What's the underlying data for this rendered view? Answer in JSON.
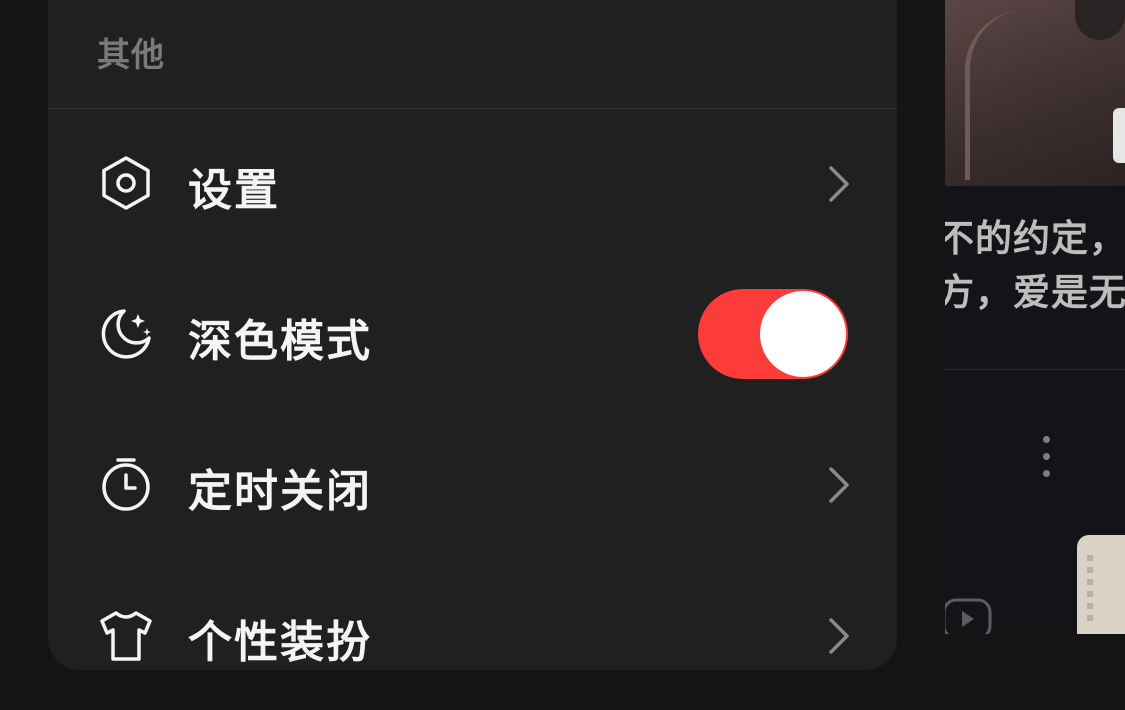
{
  "menu": {
    "section_title": "其他",
    "items": [
      {
        "icon": "settings-hexagon-icon",
        "label": "设置",
        "control": "chevron"
      },
      {
        "icon": "moon-stars-icon",
        "label": "深色模式",
        "control": "toggle",
        "toggle_on": true
      },
      {
        "icon": "timer-icon",
        "label": "定时关闭",
        "control": "chevron"
      },
      {
        "icon": "tshirt-icon",
        "label": "个性装扮",
        "control": "chevron"
      }
    ]
  },
  "feed": {
    "text_line_1": "不的约定，",
    "text_line_2": "方，爱是无"
  },
  "colors": {
    "toggle_on": "#fc3b3b",
    "panel_bg": "#202020",
    "page_bg": "#141414"
  }
}
